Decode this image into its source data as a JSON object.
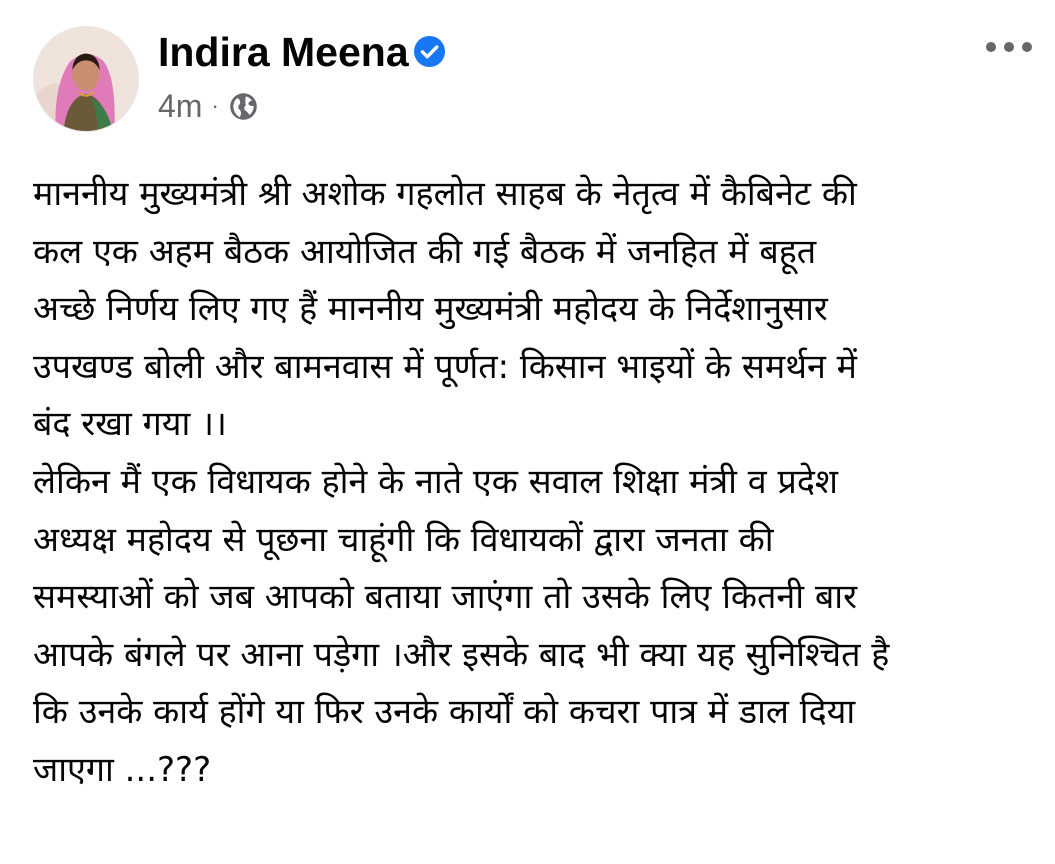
{
  "post": {
    "author": {
      "name": "Indira Meena",
      "verified": true,
      "avatar_icon": "profile-photo"
    },
    "timestamp": "4m",
    "separator": "·",
    "audience_icon": "globe-public-icon",
    "more_icon": "more-options-icon",
    "text_lines": [
      "माननीय मुख्यमंत्री श्री अशोक गहलोत साहब के नेतृत्व में कैबिनेट की",
      "कल एक अहम बैठक आयोजित की गई बैठक में जनहित में बहूत",
      "अच्छे निर्णय लिए गए हैं माननीय मुख्यमंत्री महोदय के निर्देशानुसार",
      "उपखण्ड बोली और बामनवास में पूर्णत: किसान भाइयों के समर्थन में",
      "बंद रखा गया ।।",
      "लेकिन मैं एक विधायक होने के नाते एक सवाल शिक्षा मंत्री व प्रदेश",
      "अध्यक्ष महोदय से पूछना चाहूंगी कि विधायकों द्वारा जनता की",
      "समस्याओं को जब आपको बताया जाएंगा तो उसके लिए कितनी बार",
      "आपके बंगले पर आना पड़ेगा ।और इसके बाद भी क्या यह सुनिश्चित है",
      "कि उनके कार्य होंगे या फिर उनके कार्यों को कचरा पात्र में डाल दिया",
      "जाएगा ...???"
    ]
  },
  "colors": {
    "text_primary": "#050505",
    "text_secondary": "#65676b",
    "verified_blue": "#1877f2",
    "background": "#ffffff"
  }
}
